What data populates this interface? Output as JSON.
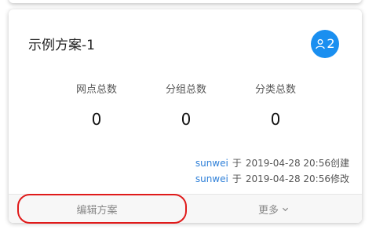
{
  "card": {
    "title": "示例方案-1",
    "member_count": "2",
    "stats": [
      {
        "label": "网点总数",
        "value": "0"
      },
      {
        "label": "分组总数",
        "value": "0"
      },
      {
        "label": "分类总数",
        "value": "0"
      }
    ],
    "created": {
      "user": "sunwei",
      "prefix": "于",
      "time": "2019-04-28 20:56创建"
    },
    "modified": {
      "user": "sunwei",
      "prefix": "于",
      "time": "2019-04-28 20:56修改"
    },
    "footer": {
      "edit_label": "编辑方案",
      "more_label": "更多"
    }
  },
  "colors": {
    "accent": "#1a8ff0",
    "user_link": "#2d7fd8",
    "highlight": "#e01a1a"
  },
  "icons": {
    "member": "user-icon",
    "more": "chevron-down-icon"
  }
}
